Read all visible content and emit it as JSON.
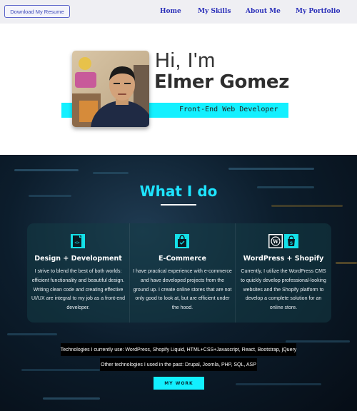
{
  "nav": {
    "resume_label": "Download My Resume",
    "links": [
      "Home",
      "My Skills",
      "About Me",
      "My Portfolio"
    ]
  },
  "hero": {
    "greeting": "Hi, I'm",
    "name": "Elmer Gomez",
    "role": "Front-End Web Developer"
  },
  "services": {
    "title": "What I do",
    "items": [
      {
        "icon": "code-file-icon",
        "title": "Design + Development",
        "text": "I strive to blend the best of both worlds: efficient functionality and beautiful design. Writing clean code and creating effective UI/UX are integral to my job as a front-end developer."
      },
      {
        "icon": "shopping-bag-icon",
        "title": "E-Commerce",
        "text": "I have practical experience with e-commerce and have developed projects from the ground up. I create online stores that are not only good to look at, but are efficient under the hood."
      },
      {
        "icon": "wordpress-shopify-icon",
        "title": "WordPress + Shopify",
        "text": "Currently, I utilize the WordPress CMS to quickly develop professional-looking websites and the Shopify platform to develop a complete solution for an online store."
      }
    ],
    "tech_current": "Technologies I currently use: WordPress, Shopify Liquid, HTML+CSS+Javascript, React, Bootstrap, jQuery",
    "tech_past": "Other technologies I used in the past: Drupal, Joomla, PHP, SQL, ASP",
    "work_label": "MY WORK"
  },
  "colors": {
    "accent": "#14f0ff",
    "nav_link": "#2a2fb9",
    "dark_bg": "#0c1d2c"
  }
}
